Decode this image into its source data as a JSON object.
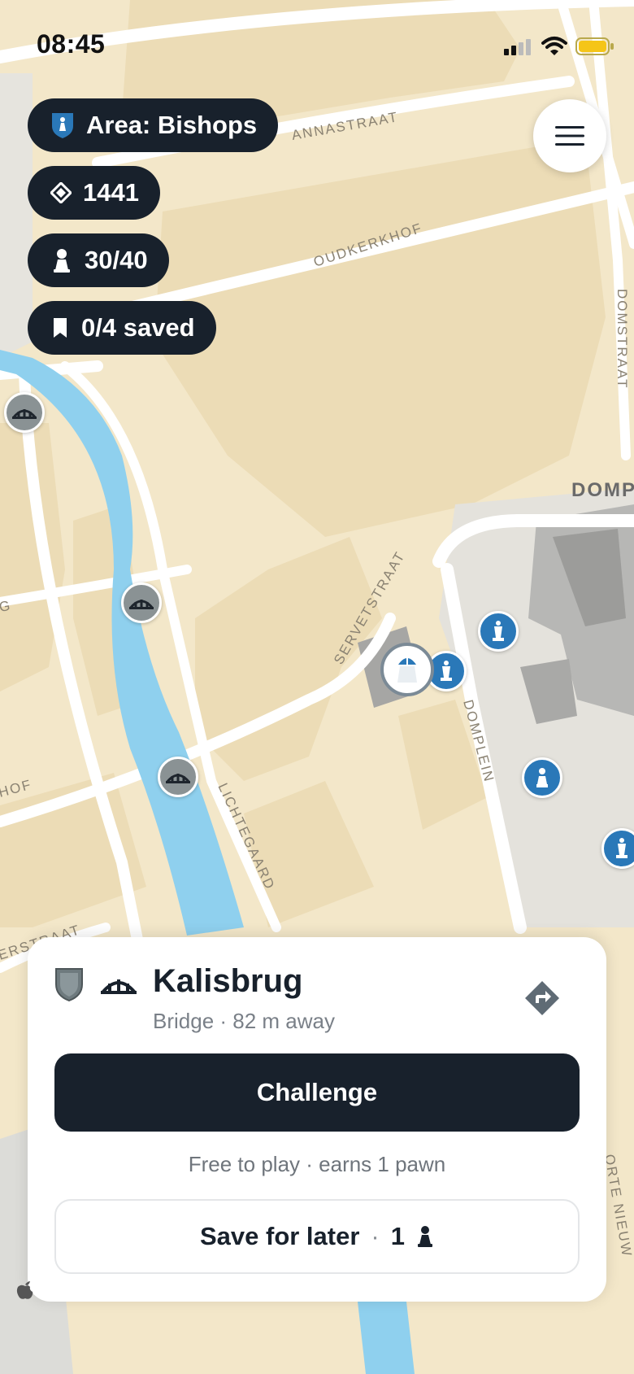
{
  "status_bar": {
    "time": "08:45"
  },
  "map": {
    "labels": {
      "annastraat": "ANNASTRAAT",
      "oudkerkhof": "OUDKERKHOF",
      "domstraat": "DOMSTRAAT",
      "domp": "DOMP",
      "servetstraat": "SERVETSTRAAT",
      "domplein": "DOMPLEIN",
      "lichtegaard": "LICHTEGAARD",
      "hof": "HOF",
      "erstraat": "ERSTRAAT",
      "g": "G",
      "orte_nieuw": "ORTE NIEUW"
    }
  },
  "hud": {
    "area": "Area: Bishops",
    "rating": "1441",
    "pieces": "30/40",
    "saved": "0/4 saved"
  },
  "card": {
    "name": "Kalisbrug",
    "subtitle": "Bridge · 82 m away",
    "challenge_label": "Challenge",
    "hint": "Free to play · earns 1 pawn",
    "save_label": "Save for later",
    "save_separator": "·",
    "save_cost": "1"
  },
  "icons": {
    "area": "bishop-shield-icon",
    "rating": "diamond-icon",
    "pieces": "pawn-icon",
    "saved": "bookmark-icon",
    "menu": "hamburger-icon",
    "directions": "directions-icon",
    "bridge": "bridge-icon",
    "shield": "shield-icon"
  },
  "colors": {
    "dark": "#18212c",
    "water": "#8fd0ee",
    "land": "#f3e7c9",
    "building": "#ead8b0",
    "marker_blue": "#2a78b8",
    "marker_gray": "#8a9294"
  }
}
